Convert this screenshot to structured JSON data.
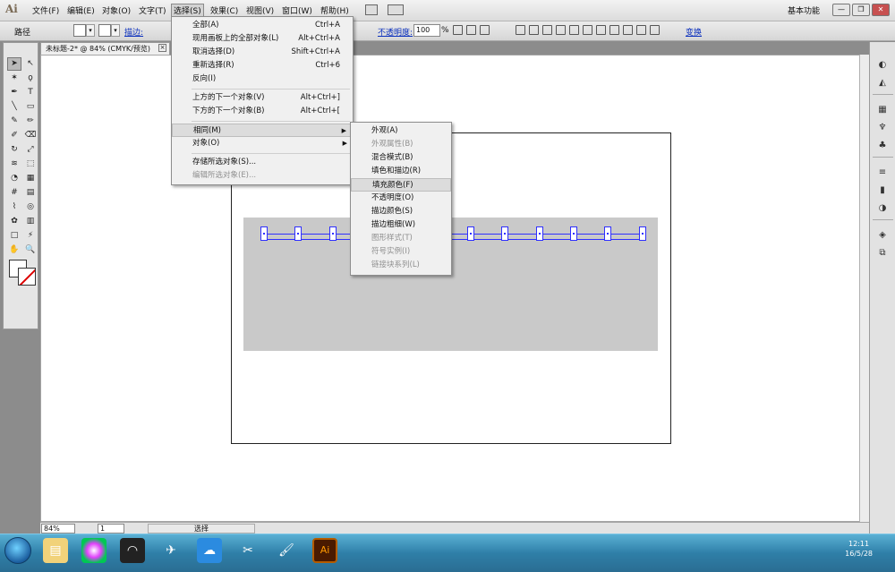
{
  "app": {
    "logo": "Ai"
  },
  "menubar": {
    "items": [
      "文件(F)",
      "编辑(E)",
      "对象(O)",
      "文字(T)",
      "选择(S)",
      "效果(C)",
      "视图(V)",
      "窗口(W)",
      "帮助(H)"
    ],
    "active": "选择(S)",
    "workspace": "基本功能"
  },
  "controlbar": {
    "object_type": "路径",
    "stroke_label": "描边:",
    "opacity_label": "不透明度:",
    "opacity_value": "100",
    "opacity_unit": "%",
    "transform_label": "变换"
  },
  "document": {
    "tab_title": "未标题-2* @ 84% (CMYK/预览)",
    "close_glyph": "×"
  },
  "select_menu": {
    "items": [
      {
        "label": "全部(A)",
        "shortcut": "Ctrl+A",
        "disabled": false
      },
      {
        "label": "现用画板上的全部对象(L)",
        "shortcut": "Alt+Ctrl+A",
        "disabled": false
      },
      {
        "label": "取消选择(D)",
        "shortcut": "Shift+Ctrl+A",
        "disabled": false
      },
      {
        "label": "重新选择(R)",
        "shortcut": "Ctrl+6",
        "disabled": false
      },
      {
        "label": "反向(I)",
        "shortcut": "",
        "disabled": false
      },
      {
        "label": "上方的下一个对象(V)",
        "shortcut": "Alt+Ctrl+]",
        "disabled": false
      },
      {
        "label": "下方的下一个对象(B)",
        "shortcut": "Alt+Ctrl+[",
        "disabled": false
      },
      {
        "label": "相同(M)",
        "shortcut": "",
        "disabled": false
      },
      {
        "label": "对象(O)",
        "shortcut": "",
        "disabled": false
      },
      {
        "label": "存储所选对象(S)...",
        "shortcut": "",
        "disabled": false
      },
      {
        "label": "编辑所选对象(E)...",
        "shortcut": "",
        "disabled": true
      }
    ]
  },
  "same_submenu": {
    "items": [
      {
        "label": "外观(A)",
        "disabled": false
      },
      {
        "label": "外观属性(B)",
        "disabled": true
      },
      {
        "label": "混合模式(B)",
        "disabled": false
      },
      {
        "label": "填色和描边(R)",
        "disabled": false
      },
      {
        "label": "填充颜色(F)",
        "disabled": false,
        "highlighted": true
      },
      {
        "label": "不透明度(O)",
        "disabled": false
      },
      {
        "label": "描边颜色(S)",
        "disabled": false
      },
      {
        "label": "描边粗细(W)",
        "disabled": false
      },
      {
        "label": "图形样式(T)",
        "disabled": true
      },
      {
        "label": "符号实例(I)",
        "disabled": true
      },
      {
        "label": "链接块系列(L)",
        "disabled": true
      }
    ]
  },
  "statusbar": {
    "zoom": "84%",
    "page": "1",
    "status": "选择"
  },
  "taskbar": {
    "time": "12:11",
    "date": "16/5/28",
    "ai_label": "Ai"
  },
  "colors": {
    "selection": "#2f2fff",
    "gray_rect": "#c9c9c9",
    "menu_bg": "#f0f0f0"
  }
}
